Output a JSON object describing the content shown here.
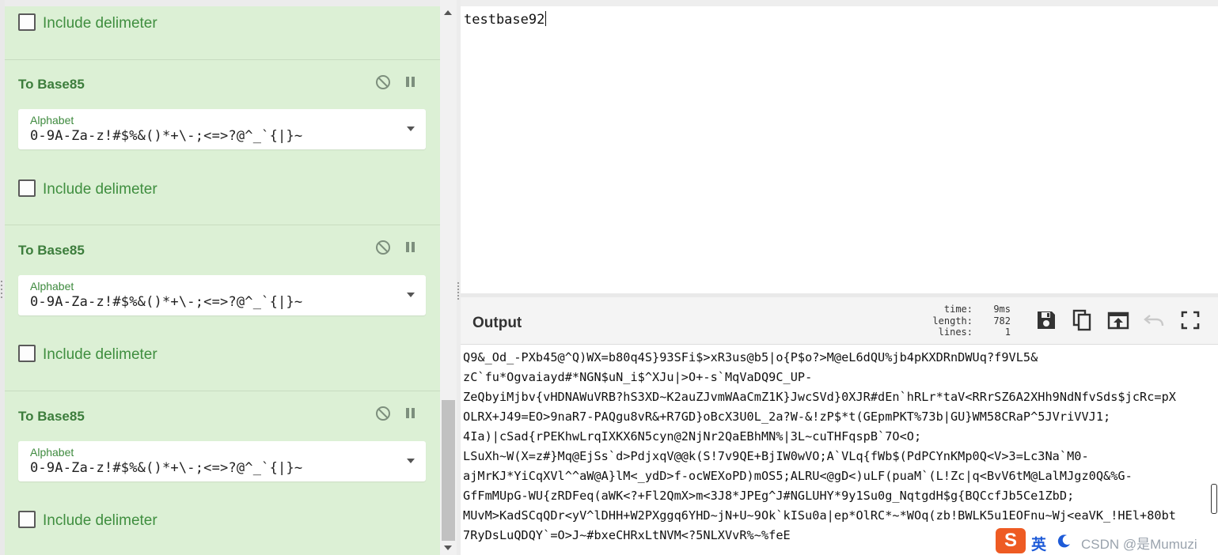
{
  "recipe": {
    "top_checkbox_label": "Include delimeter",
    "operations": [
      {
        "title": "To Base85",
        "alphabet_label": "Alphabet",
        "alphabet_value": "0-9A-Za-z!#$%&()*+\\-;<=>?@^_`{|}~",
        "include_delimiter_label": "Include delimeter"
      },
      {
        "title": "To Base85",
        "alphabet_label": "Alphabet",
        "alphabet_value": "0-9A-Za-z!#$%&()*+\\-;<=>?@^_`{|}~",
        "include_delimiter_label": "Include delimeter"
      },
      {
        "title": "To Base85",
        "alphabet_label": "Alphabet",
        "alphabet_value": "0-9A-Za-z!#$%&()*+\\-;<=>?@^_`{|}~",
        "include_delimiter_label": "Include delimeter"
      }
    ]
  },
  "input": {
    "text": "testbase92"
  },
  "output": {
    "title": "Output",
    "stats": {
      "time_label": "time:",
      "time_value": "9ms",
      "length_label": "length:",
      "length_value": "782",
      "lines_label": "lines:",
      "lines_value": "1"
    },
    "lines": [
      "Q9&_Od_-PXb45@^Q)WX=b80q4S}93SFi$>xR3us@b5|o{P$o?>M@eL6dQU%jb4pKXDRnDWUq?f9VL5&",
      "zC`fu*Ogvaiayd#*NGN$uN_i$^XJu|>O+-s`MqVaDQ9C_UP-",
      "ZeQbyiMjbv{vHDNAWuVRB?hS3XD~K2auZJvmWAaCmZ1K}JwcSVd}0XJR#dEn`hRLr*taV<RRrSZ6A2XHh9NdNfvSds$jcRc=pX",
      "OLRX+J49=EO>9naR7-PAQgu8vR&+R7GD}oBcX3U0L_2a?W-&!zP$*t(GEpmPKT%73b|GU}WM58CRaP^5JVriVVJ1;",
      "4Ia)|cSad{rPEKhwLrqIXKX6N5cyn@2NjNr2QaEBhMN%|3L~cuTHFqspB`7O<O;",
      "LSuXh~W(X=z#}Mq@EjSs`d>PdjxqV@@k(S!7v9QE+BjIW0wVO;A`VLq{fWb$(PdPCYnKMp0Q<V>3=Lc3Na`M0-",
      "ajMrKJ*YiCqXVl^^aW@A}lM<_ydD>f-ocWEXoPD)mOS5;ALRU<@gD<)uLF(puaM`(L!Zc|q<BvV6tM@LalMJgz0Q&%G-",
      "GfFmMUpG-WU{zRDFeq(aWK<?+Fl2QmX>m<3J8*JPEg^J#NGLUHY*9y1Su0g_NqtgdH$g{BQCcfJb5Ce1ZbD;",
      "MUvM>KadSCqQDr<yV^lDHH+W2PXggq6YHD~jN+U~9Ok`kISu0a|ep*OlRC*~*WOq(zb!BWLK5u1EOFnu~Wj<eaVK_!HEl+80bt",
      "7RyDsLuQDQY`=O>J~#bxeCHRxLtNVM<?5NLXVvR%~%feE"
    ]
  },
  "tray": {
    "ime_logo": "S",
    "ime_language": "英",
    "watermark": "CSDN @是Mumuzi"
  },
  "icons": {
    "disable": "no-entry-icon",
    "pause": "pause-icon",
    "save": "save-icon",
    "copy": "copy-icon",
    "replace_input": "replace-input-icon",
    "undo": "undo-icon",
    "maximise": "maximise-icon"
  }
}
